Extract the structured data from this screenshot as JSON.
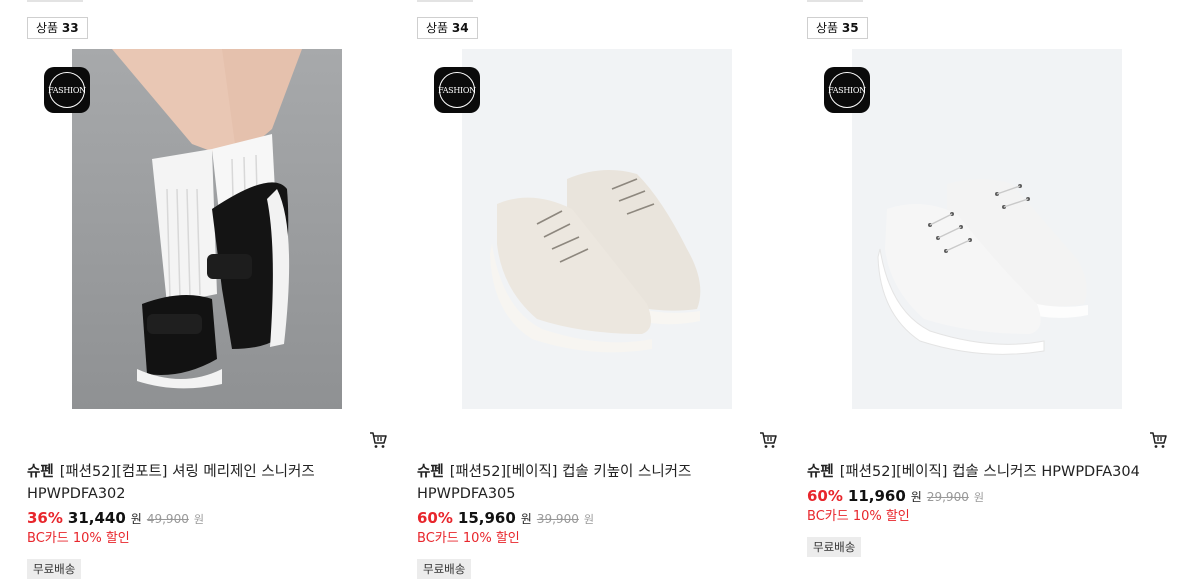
{
  "products": [
    {
      "rank_label": "상품",
      "rank_number": "33",
      "logo_text": "FASHION",
      "brand": "슈펜",
      "name": "[패션52][컴포트] 셔링 메리제인 스니커즈 HPWPDFA302",
      "discount_rate": "36%",
      "sale_price": "31,440",
      "currency": "원",
      "original_price": "49,900",
      "promo": "BC카드 10% 할인",
      "shipping": "무료배송",
      "image": "black-maryjane-sneaker-photo"
    },
    {
      "rank_label": "상품",
      "rank_number": "34",
      "logo_text": "FASHION",
      "brand": "슈펜",
      "name": "[패션52][베이직] 컵솔 키높이 스니커즈 HPWPDFA305",
      "discount_rate": "60%",
      "sale_price": "15,960",
      "currency": "원",
      "original_price": "39,900",
      "promo": "BC카드 10% 할인",
      "shipping": "무료배송",
      "image": "beige-cupsole-sneaker-photo"
    },
    {
      "rank_label": "상품",
      "rank_number": "35",
      "logo_text": "FASHION",
      "brand": "슈펜",
      "name": "[패션52][베이직] 컵솔 스니커즈 HPWPDFA304",
      "discount_rate": "60%",
      "sale_price": "11,960",
      "currency": "원",
      "original_price": "29,900",
      "promo": "BC카드 10% 할인",
      "shipping": "무료배송",
      "image": "white-cupsole-sneaker-photo"
    }
  ],
  "colors": {
    "discount": "#e8262c",
    "badge_bg": "#ececec"
  },
  "icons": {
    "cart": "cart-icon",
    "logo": "fashion52-logo-icon"
  }
}
